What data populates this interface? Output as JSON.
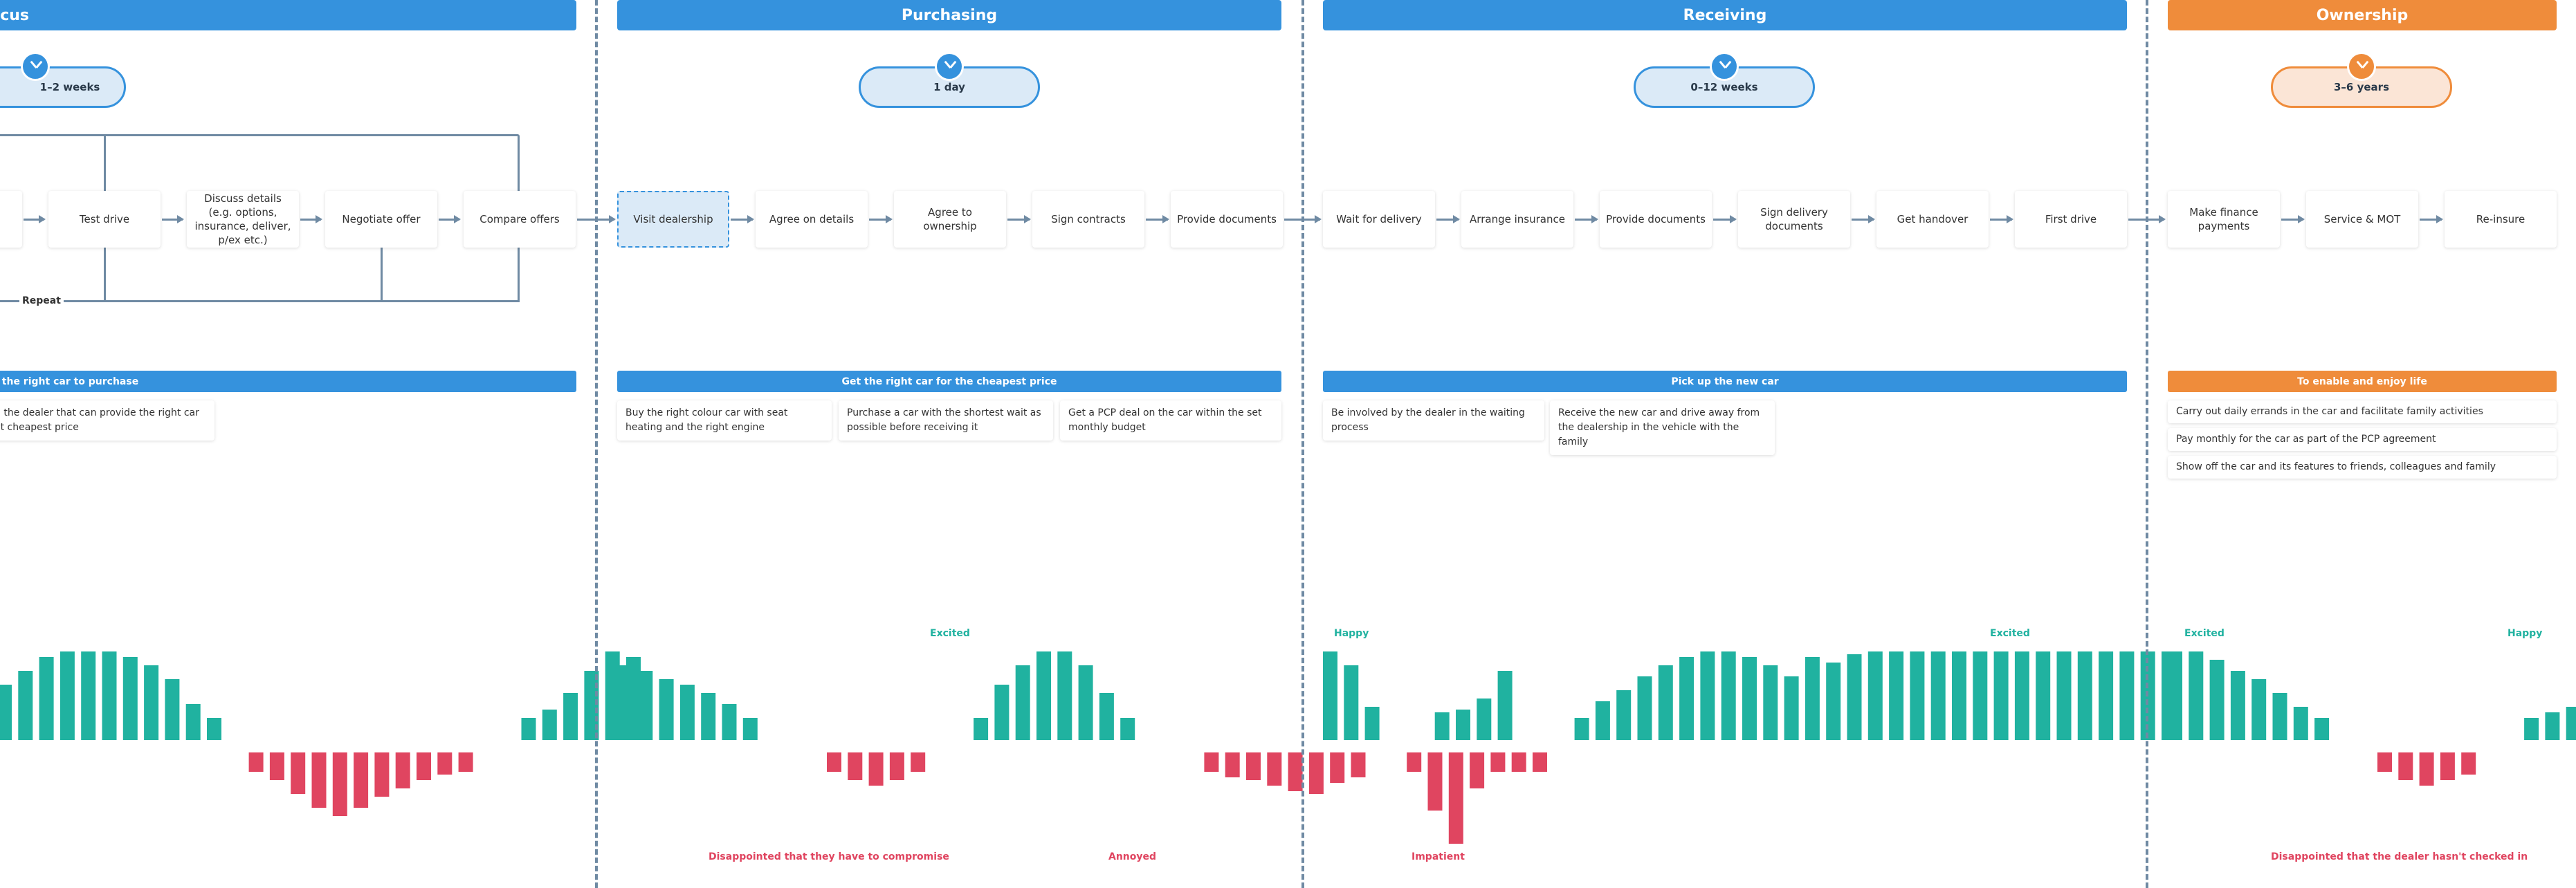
{
  "phases": [
    {
      "id": "focus",
      "title": "Focus",
      "color": "blue",
      "duration": "1–2 weeks",
      "goal": "the right car to purchase"
    },
    {
      "id": "purchasing",
      "title": "Purchasing",
      "color": "blue",
      "duration": "1 day",
      "goal": "Get the right car for the cheapest price"
    },
    {
      "id": "receiving",
      "title": "Receiving",
      "color": "blue",
      "duration": "0–12 weeks",
      "goal": "Pick up the new car"
    },
    {
      "id": "ownership",
      "title": "Ownership",
      "color": "orange",
      "duration": "3–6 years",
      "goal": "To enable and enjoy life"
    }
  ],
  "steps": {
    "focus": [
      "Test drive",
      "Discuss details (e.g. options, insurance, deliver, p/ex etc.)",
      "Negotiate offer",
      "Compare offers"
    ],
    "purchasing": [
      "Visit dealership",
      "Agree on details",
      "Agree to ownership",
      "Sign contracts",
      "Provide documents"
    ],
    "receiving": [
      "Wait for delivery",
      "Arrange insurance",
      "Provide documents",
      "Sign delivery documents",
      "Get handover",
      "First drive"
    ],
    "ownership": [
      "Make finance payments",
      "Service & MOT",
      "Re-insure"
    ]
  },
  "repeat_label": "Repeat",
  "goal_details": {
    "focus": [
      "d the dealer that can provide the right car at cheapest price"
    ],
    "purchasing": [
      "Buy the right colour car with seat heating and the right engine",
      "Purchase a car with the shortest wait as possible before receiving it",
      "Get a PCP deal on the car within the set monthly budget"
    ],
    "receiving": [
      "Be involved by the dealer in the waiting process",
      "Receive the new car and drive away from the dealership in the vehicle with the family"
    ],
    "ownership": [
      "Carry out daily errands in the car and facilitate family activities",
      "Pay monthly for the car as part of the PCP agreement",
      "Show off the car and its features to friends, colleagues and family"
    ]
  },
  "emotion_labels": {
    "purchasing_excited": "Excited",
    "receiving_happy": "Happy",
    "receiving_excited": "Excited",
    "ownership_excited": "Excited",
    "ownership_happy": "Happy",
    "purchasing_disappointed": "Disappointed that they have to compromise",
    "purchasing_annoyed": "Annoyed",
    "receiving_impatient": "Impatient",
    "ownership_disappointed": "Disappointed that the dealer hasn't checked in"
  },
  "colors": {
    "accent_blue": "#3592dd",
    "accent_orange": "#ef8c3b",
    "positive": "#20b2a0",
    "negative": "#e04560",
    "connector": "#6f8aa3"
  },
  "chart_data": {
    "type": "bar",
    "description_scale": "emotion level, positive above baseline, negative below",
    "ylim": [
      -4,
      4
    ],
    "series": [
      {
        "segment": "focus",
        "values": [
          2,
          2.5,
          3,
          3.2,
          3.2,
          3.2,
          3,
          2.7,
          2.2,
          1.3,
          0.8,
          0,
          -0.7,
          -1,
          -1.5,
          -2,
          -2.3,
          -2,
          -1.6,
          -1.3,
          -1,
          -0.8,
          -0.7,
          0,
          0,
          0.8,
          1.1,
          1.7,
          2.5,
          3.2,
          3
        ]
      },
      {
        "segment": "purchasing",
        "values": [
          2.7,
          2.5,
          2.2,
          2,
          1.7,
          1.3,
          0.8,
          0,
          0,
          0,
          -0.7,
          -1,
          -1.2,
          -1,
          -0.7,
          0,
          0,
          0.8,
          2,
          2.7,
          3.2,
          3.2,
          2.7,
          1.7,
          0.8,
          0,
          0,
          0,
          -0.7,
          -0.9,
          -1,
          -1.2,
          -1.4,
          -1.5,
          -1.1,
          -0.9,
          0,
          0,
          0,
          1,
          1.1,
          1.5,
          2.5
        ]
      },
      {
        "segment": "receiving",
        "values": [
          3.2,
          2.7,
          1.2,
          0,
          -0.7,
          -2.1,
          -3.3,
          -1.3,
          -0.7,
          -0.7,
          -0.7,
          0,
          0.8,
          1.4,
          1.8,
          2.3,
          2.7,
          3,
          3.2,
          3.2,
          3,
          2.7,
          2.3,
          3,
          2.8,
          3.1,
          3.2,
          3.2,
          3.2,
          3.2,
          3.2,
          3.2,
          3.2,
          3.2,
          3.2,
          3.2,
          3.2,
          3.2,
          3.2,
          3.2,
          3.2
        ]
      },
      {
        "segment": "ownership",
        "values": [
          3.2,
          3.2,
          2.9,
          2.5,
          2.2,
          1.7,
          1.2,
          0.8,
          0,
          0,
          -0.7,
          -1,
          -1.2,
          -1,
          -0.8,
          0,
          0,
          0.8,
          1,
          1.2,
          1.4,
          1.5,
          1.5,
          1.3
        ]
      }
    ]
  }
}
